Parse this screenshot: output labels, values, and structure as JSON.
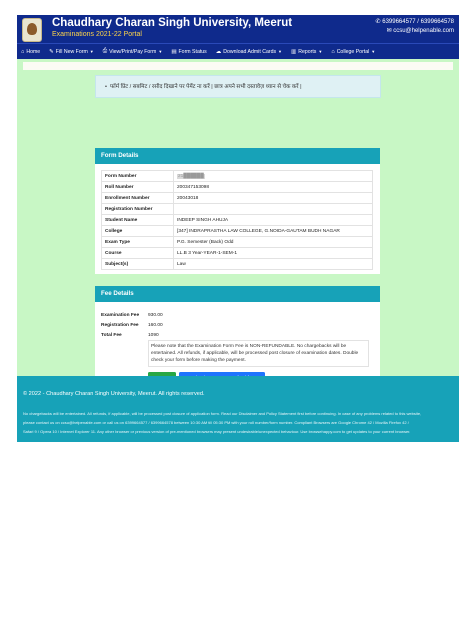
{
  "header": {
    "title": "Chaudhary Charan Singh University, Meerut",
    "subtitle": "Examinations 2021-22 Portal",
    "phone": "6399664577 / 6399664578",
    "email": "ccsu@helpenable.com"
  },
  "nav": [
    {
      "label": "Home",
      "icon": "home-icon",
      "caret": false
    },
    {
      "label": "Fill New Form",
      "icon": "edit-icon",
      "caret": true
    },
    {
      "label": "View/Print/Pay Form",
      "icon": "print-icon",
      "caret": true
    },
    {
      "label": "Form Status",
      "icon": "document-icon",
      "caret": false
    },
    {
      "label": "Download Admit Cards",
      "icon": "cloud-download-icon",
      "caret": true
    },
    {
      "label": "Reports",
      "icon": "report-icon",
      "caret": true
    },
    {
      "label": "College Portal",
      "icon": "bank-icon",
      "caret": true
    }
  ],
  "notice": "फॉर्म प्रिंट / सबमिट / रसीद दिखाने पर पेमेंट ना करें | छात्र अपने सभी दस्तावेज़ ध्यान से चेक करें |",
  "form_details": {
    "heading": "Form Details",
    "rows": [
      {
        "label": "Form Number",
        "value": "21██████"
      },
      {
        "label": "Roll Number",
        "value": "200347153098"
      },
      {
        "label": "Enrollment Number",
        "value": "20043018"
      },
      {
        "label": "Registration Number",
        "value": ""
      },
      {
        "label": "Student Name",
        "value": "INDEEP SINGH AHUJA"
      },
      {
        "label": "College",
        "value": "[347] INDRAPRASTHA LAW COLLEGE, G.NOIDA-GAUTAM BUDH NAGAR"
      },
      {
        "label": "Exam Type",
        "value": "P.G. Semester (Back) Odd"
      },
      {
        "label": "Course",
        "value": "LL.B 3 Year-YEAR-1-SEM-1"
      },
      {
        "label": "Subject(s)",
        "value": "Law"
      }
    ]
  },
  "fee_details": {
    "heading": "Fee Details",
    "rows": [
      {
        "label": "Examination Fee",
        "value": "930.00"
      },
      {
        "label": "Registration Fee",
        "value": "160.00"
      },
      {
        "label": "Total Fee",
        "value": "1090"
      }
    ],
    "note": "Please note that the Examination Form Fee is NON-REFUNDABLE. No chargebacks will be entertained. All refunds, if applicable, will be processed post closure of examination dates. Double check your form before making the payment.",
    "pay_button": "Pay Now",
    "refund_button": "Download Excess Fee Refund format"
  },
  "footer": {
    "copyright": "© 2022 - Chaudhary Charan Singh University, Meerut. All rights reserved.",
    "line1": "No chargebacks will be entertained. All refunds, if applicable, will be processed post closure of application form. Read our Disclaimer and Policy Statement first before continuing. In case of any problems related to this website,",
    "line2": "please contact us on ccsu@helpenable.com or call us on 6399664577 / 6399664578 between 10:30 AM till 05:30 PM with your roll number/form number. Compliant Browsers are Google Chrome 42 / Mozilla Firefox 42 /",
    "line3": "Safari 9 / Opera 10 / Internet Explorer 11. Any other browser or previous version of pre-mentioned browsers may present undesirable/unexpected behaviour. Use browsehappy.com to get updates to your current browser."
  }
}
